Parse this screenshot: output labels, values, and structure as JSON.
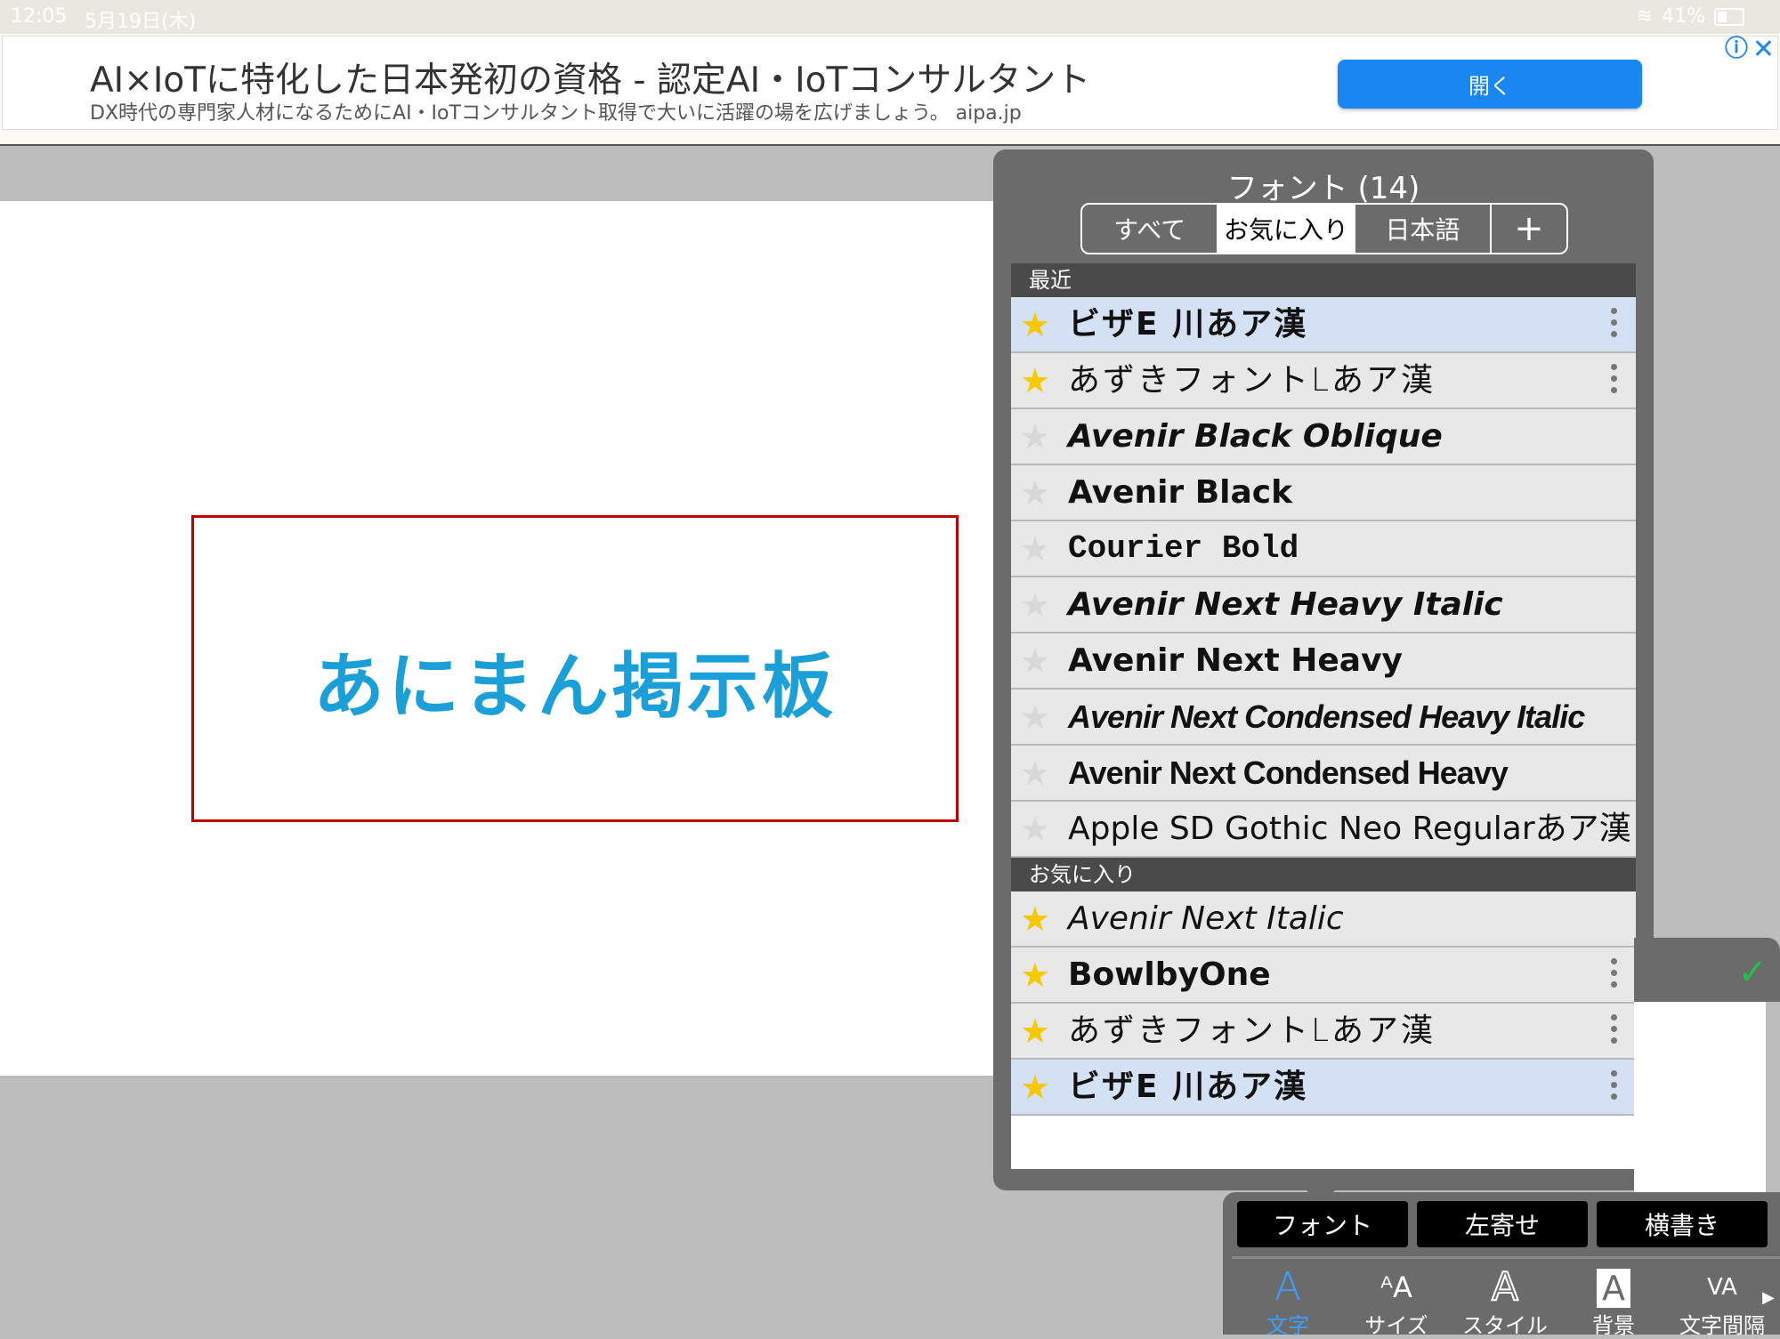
{
  "status": {
    "time": "12:05",
    "date": "5月19日(木)",
    "battery": "41%"
  },
  "ad": {
    "title": "AI×IoTに特化した日本発初の資格 - 認定AI・IoTコンサルタント",
    "subtitle": "DX時代の専門家人材になるためにAI・IoTコンサルタント取得で大いに活躍の場を広げましょう。 aipa.jp",
    "open_label": "開く",
    "info_icon": "ⓘ",
    "close_icon": "✕"
  },
  "canvas": {
    "text": "あにまん掲示板"
  },
  "font_panel": {
    "title": "フォント (14)",
    "segments": [
      "すべて",
      "お気に入り",
      "日本語",
      "+"
    ],
    "active_segment": "お気に入り",
    "recent_header": "最近",
    "recent": [
      {
        "name": "ビザE 川あア漢",
        "fav": true,
        "more": true,
        "selected": true
      },
      {
        "name": "あずきフォントLあア漢",
        "fav": true,
        "more": true,
        "selected": false
      },
      {
        "name": "Avenir Black Oblique",
        "fav": false,
        "more": false,
        "selected": false
      },
      {
        "name": "Avenir Black",
        "fav": false,
        "more": false,
        "selected": false
      },
      {
        "name": "Courier Bold",
        "fav": false,
        "more": false,
        "selected": false
      },
      {
        "name": "Avenir Next Heavy Italic",
        "fav": false,
        "more": false,
        "selected": false
      },
      {
        "name": "Avenir Next Heavy",
        "fav": false,
        "more": false,
        "selected": false
      },
      {
        "name": "Avenir Next Condensed Heavy Italic",
        "fav": false,
        "more": false,
        "selected": false
      },
      {
        "name": "Avenir Next Condensed Heavy",
        "fav": false,
        "more": false,
        "selected": false
      },
      {
        "name": "Apple SD Gothic Neo Regularあア漢",
        "fav": false,
        "more": false,
        "selected": false
      }
    ],
    "favorites_header": "お気に入り",
    "favorites": [
      {
        "name": "Avenir Next Italic",
        "fav": true,
        "more": false,
        "selected": false
      },
      {
        "name": "BowlbyOne",
        "fav": true,
        "more": true,
        "selected": false
      },
      {
        "name": "あずきフォントLあア漢",
        "fav": true,
        "more": true,
        "selected": false
      },
      {
        "name": "ビザE 川あア漢",
        "fav": true,
        "more": true,
        "selected": true
      }
    ]
  },
  "toolbar": {
    "buttons": [
      "フォント",
      "左寄せ",
      "横書き"
    ],
    "tabs": [
      {
        "icon": "A",
        "label": "文字",
        "active": true
      },
      {
        "icon": "ᴬA",
        "label": "サイズ",
        "active": false
      },
      {
        "icon": "A",
        "label": "スタイル",
        "active": false
      },
      {
        "icon": "A",
        "label": "背景",
        "active": false
      },
      {
        "icon": "VA",
        "label": "文字間隔",
        "active": false
      }
    ]
  }
}
